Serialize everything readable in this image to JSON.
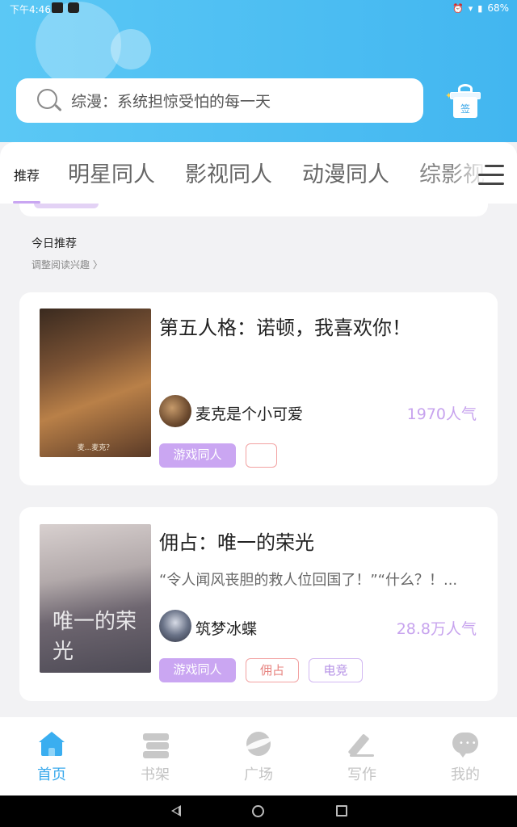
{
  "status_bar": {
    "time": "下午4:46",
    "battery": "68%"
  },
  "search": {
    "text": "综漫：系统担惊受怕的每一天"
  },
  "gift": {
    "label": "签"
  },
  "tabs": [
    {
      "label": "推荐",
      "active": true
    },
    {
      "label": "明星同人"
    },
    {
      "label": "影视同人"
    },
    {
      "label": "动漫同人"
    },
    {
      "label": "综影视"
    }
  ],
  "section": {
    "title": "今日推荐",
    "subtitle": "调整阅读兴趣 〉"
  },
  "books": [
    {
      "title": "第五人格：诺顿，我喜欢你！",
      "cover_caption": "麦...麦克？",
      "author": "麦克是个小可爱",
      "popularity": "1970人气",
      "tags": [
        "游戏同人",
        ""
      ]
    },
    {
      "title": "佣占：唯一的荣光",
      "cover_caption": "唯一的荣光",
      "description": "“令人闻风丧胆的救人位回国了！”“什么？！...",
      "author": "筑梦冰蝶",
      "popularity": "28.8万人气",
      "tags": [
        "游戏同人",
        "佣占",
        "电竞"
      ]
    }
  ],
  "bottom_nav": [
    {
      "label": "首页",
      "active": true
    },
    {
      "label": "书架"
    },
    {
      "label": "广场"
    },
    {
      "label": "写作"
    },
    {
      "label": "我的"
    }
  ],
  "colors": {
    "accent": "#39a9ec",
    "tag_purple": "#caa6f2",
    "popularity": "#c7a3ee",
    "header": "#4ab9f2"
  }
}
